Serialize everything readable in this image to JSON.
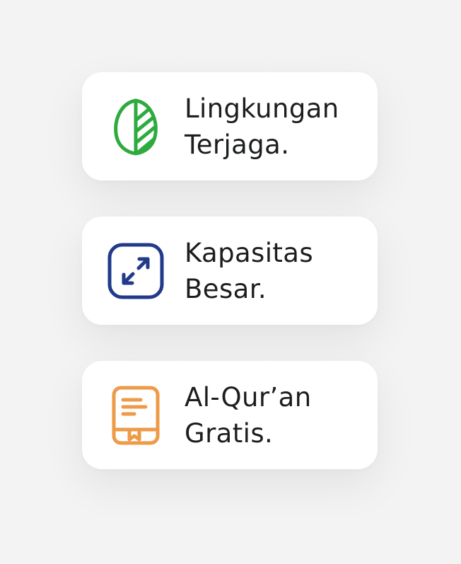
{
  "features": [
    {
      "icon": "leaf-icon",
      "color": "#2dab3f",
      "line1": "Lingkungan",
      "line2": "Terjaga."
    },
    {
      "icon": "expand-arrows-icon",
      "color": "#223a8a",
      "line1": "Kapasitas",
      "line2": "Besar."
    },
    {
      "icon": "book-icon",
      "color": "#ee9a47",
      "line1": "Al-Qur’an",
      "line2": "Gratis."
    }
  ]
}
